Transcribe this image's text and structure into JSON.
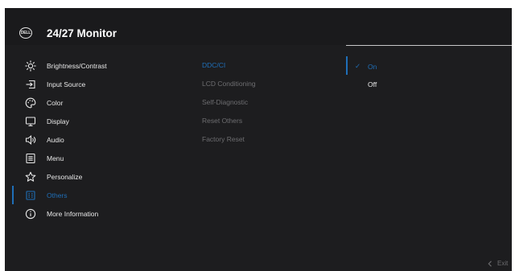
{
  "header": {
    "logo_text": "DELL",
    "title": "24/27 Monitor"
  },
  "menu": {
    "items": [
      {
        "label": "Brightness/Contrast",
        "icon": "brightness-icon"
      },
      {
        "label": "Input Source",
        "icon": "input-source-icon"
      },
      {
        "label": "Color",
        "icon": "color-palette-icon"
      },
      {
        "label": "Display",
        "icon": "display-icon"
      },
      {
        "label": "Audio",
        "icon": "speaker-icon"
      },
      {
        "label": "Menu",
        "icon": "menu-icon"
      },
      {
        "label": "Personalize",
        "icon": "star-icon"
      },
      {
        "label": "Others",
        "icon": "others-icon"
      },
      {
        "label": "More Information",
        "icon": "info-icon"
      }
    ],
    "active": "Others"
  },
  "submenu": {
    "items": [
      {
        "label": "DDC/CI"
      },
      {
        "label": "LCD Conditioning"
      },
      {
        "label": "Self-Diagnostic"
      },
      {
        "label": "Reset Others"
      },
      {
        "label": "Factory Reset"
      }
    ],
    "selected": "DDC/CI"
  },
  "options": {
    "items": [
      {
        "label": "On"
      },
      {
        "label": "Off"
      }
    ],
    "selected": "On"
  },
  "footer": {
    "exit_label": "Exit",
    "exit_icon": "chevron-left-icon"
  },
  "colors": {
    "accent": "#1f6fb8",
    "background": "#1d1d1f",
    "text": "#e8e8e8",
    "dim_text": "#6d6d70"
  }
}
